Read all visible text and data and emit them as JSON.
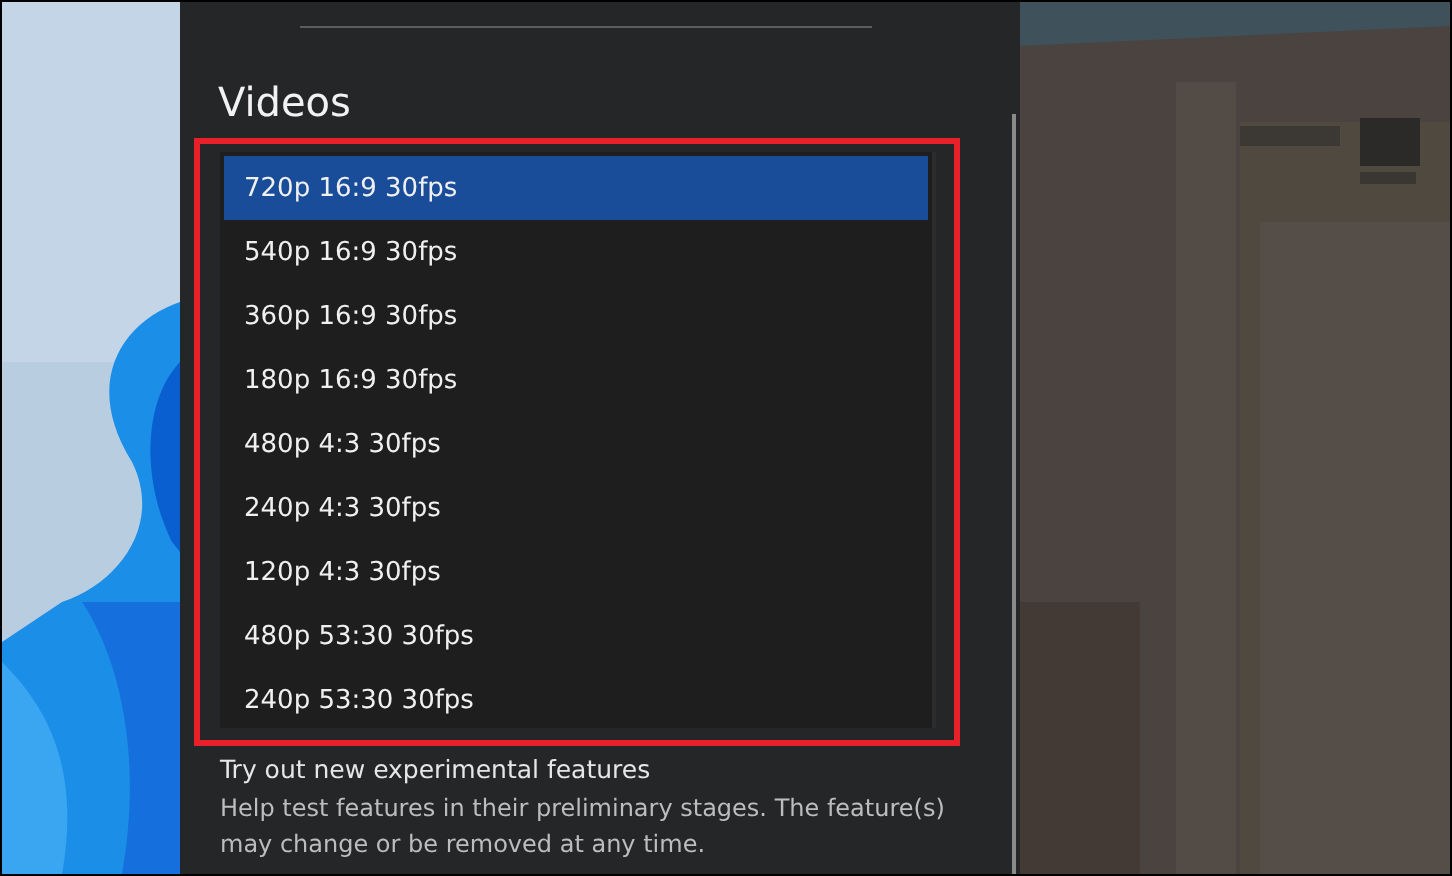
{
  "section_title": "Videos",
  "video_options": [
    {
      "label": "720p 16:9 30fps",
      "selected": true
    },
    {
      "label": "540p 16:9 30fps",
      "selected": false
    },
    {
      "label": "360p 16:9 30fps",
      "selected": false
    },
    {
      "label": "180p 16:9 30fps",
      "selected": false
    },
    {
      "label": "480p 4:3 30fps",
      "selected": false
    },
    {
      "label": "240p 4:3 30fps",
      "selected": false
    },
    {
      "label": "120p 4:3 30fps",
      "selected": false
    },
    {
      "label": "480p 53:30 30fps",
      "selected": false
    },
    {
      "label": "240p 53:30 30fps",
      "selected": false
    }
  ],
  "experimental": {
    "title": "Try out new experimental features",
    "description": "Help test features in their preliminary stages. The feature(s) may change or be removed at any time."
  }
}
